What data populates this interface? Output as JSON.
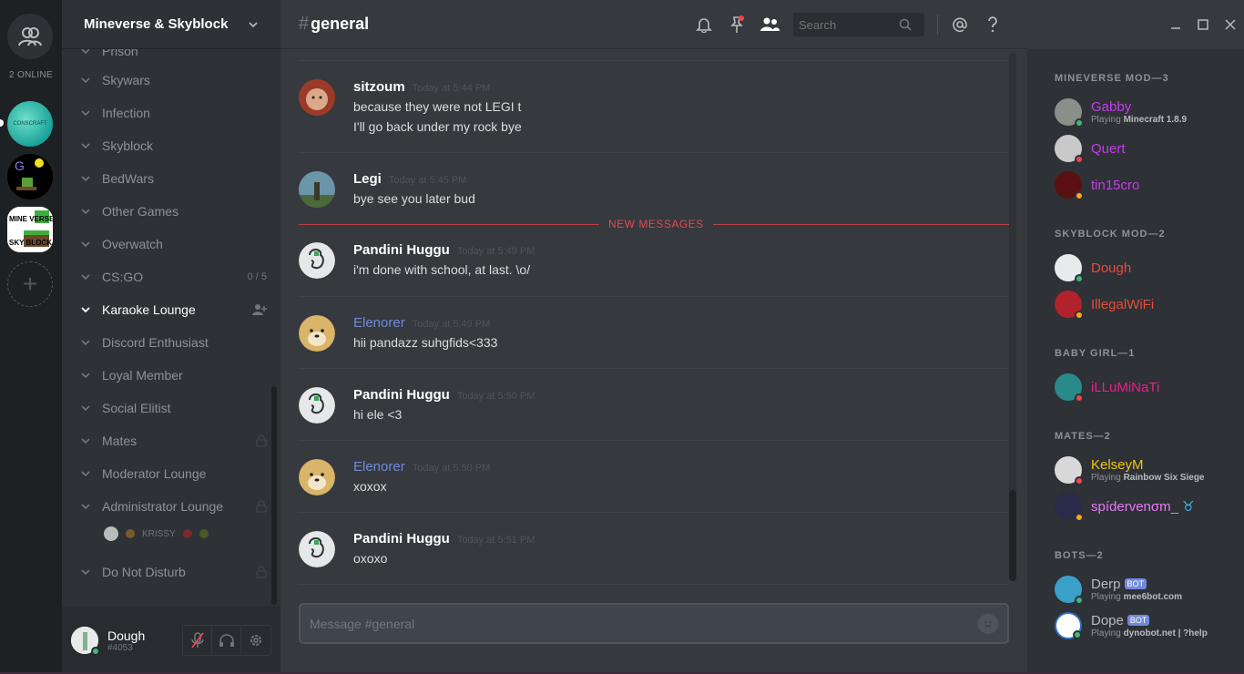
{
  "guilds": {
    "online_count": "2 ONLINE",
    "g1_label": "CONSCRAFT",
    "g3_top": "MINE VERSE",
    "g3_bottom": "SKY BLOCK"
  },
  "server": {
    "name": "Mineverse & Skyblock"
  },
  "categories": [
    {
      "label": "Prison"
    },
    {
      "label": "Skywars"
    },
    {
      "label": "Infection"
    },
    {
      "label": "Skyblock"
    },
    {
      "label": "BedWars"
    },
    {
      "label": "Other Games"
    },
    {
      "label": "Overwatch"
    },
    {
      "label": "CS:GO",
      "right": "0 / 5"
    },
    {
      "label": "Karaoke Lounge"
    },
    {
      "label": "Discord Enthusiast"
    },
    {
      "label": "Loyal Member"
    },
    {
      "label": "Social Elitist"
    },
    {
      "label": "Mates"
    },
    {
      "label": "Moderator Lounge"
    },
    {
      "label": "Administrator Lounge"
    },
    {
      "label": "Do Not Disturb"
    }
  ],
  "voice_user": "KRISSY",
  "user": {
    "name": "Dough",
    "tag": "#4053"
  },
  "channel": {
    "hash": "#",
    "name": "general"
  },
  "search": {
    "placeholder": "Search"
  },
  "messages": [
    {
      "user": "sitzoum",
      "time": "Today at 5:44 PM",
      "lines": [
        "because they were not LEGI t",
        "I'll go back under my rock bye"
      ],
      "color": "#ffffff"
    },
    {
      "user": "Legi",
      "time": "Today at 5:45 PM",
      "lines": [
        "bye see you later bud"
      ],
      "color": "#ffffff"
    },
    {
      "user": "Pandini Huggu",
      "time": "Today at 5:49 PM",
      "lines": [
        "i'm done with school, at last. \\o/"
      ],
      "color": "#ffffff"
    },
    {
      "user": "Elenorer",
      "time": "Today at 5:49 PM",
      "lines": [
        "hii pandazz suhgfids<333"
      ],
      "color": "#7289da"
    },
    {
      "user": "Pandini Huggu",
      "time": "Today at 5:50 PM",
      "lines": [
        "hi ele <3"
      ],
      "color": "#ffffff"
    },
    {
      "user": "Elenorer",
      "time": "Today at 5:50 PM",
      "lines": [
        "xoxox"
      ],
      "color": "#7289da"
    },
    {
      "user": "Pandini Huggu",
      "time": "Today at 5:51 PM",
      "lines": [
        "oxoxo"
      ],
      "color": "#ffffff"
    }
  ],
  "new_messages_label": "NEW MESSAGES",
  "composer": {
    "placeholder": "Message #general"
  },
  "members": {
    "roles": [
      {
        "label": "MINEVERSE MOD—3"
      },
      {
        "label": "SKYBLOCK MOD—2"
      },
      {
        "label": "BABY GIRL—1"
      },
      {
        "label": "MATES—2"
      },
      {
        "label": "BOTS—2"
      }
    ],
    "list": [
      {
        "name": "Gabby",
        "color": "#c43ee8",
        "status": "#43b581",
        "playing_prefix": "Playing ",
        "game": "Minecraft 1.8.9"
      },
      {
        "name": "Quert",
        "color": "#c43ee8",
        "status": "#f04747"
      },
      {
        "name": "tin15cro",
        "color": "#c43ee8",
        "status": "#faa61a"
      },
      {
        "name": "Dough",
        "color": "#e74c3c",
        "status": "#43b581"
      },
      {
        "name": "IllegalWiFi",
        "color": "#e74c3c",
        "status": "#faa61a"
      },
      {
        "name": "iLLuMiNaTi",
        "color": "#e91e8c",
        "status": "#f04747"
      },
      {
        "name": "KelseyM",
        "color": "#f1c40f",
        "status": "#f04747",
        "playing_prefix": "Playing ",
        "game": "Rainbow Six Siege"
      },
      {
        "name": "spídervenσm_",
        "suffix": "♉",
        "color": "#e879f9",
        "status": "#faa61a"
      },
      {
        "name": "Derp",
        "color": "#b9bbbe",
        "status": "#43b581",
        "bot": "BOT",
        "playing_prefix": "Playing ",
        "game": "mee6bot.com"
      },
      {
        "name": "Dope",
        "color": "#b9bbbe",
        "status": "#43b581",
        "bot": "BOT",
        "playing_prefix": "Playing ",
        "game": "dynobot.net | ?help"
      }
    ]
  },
  "colors": {
    "accent": "#7289da",
    "online": "#43b581",
    "dnd": "#f04747",
    "idle": "#faa61a"
  }
}
